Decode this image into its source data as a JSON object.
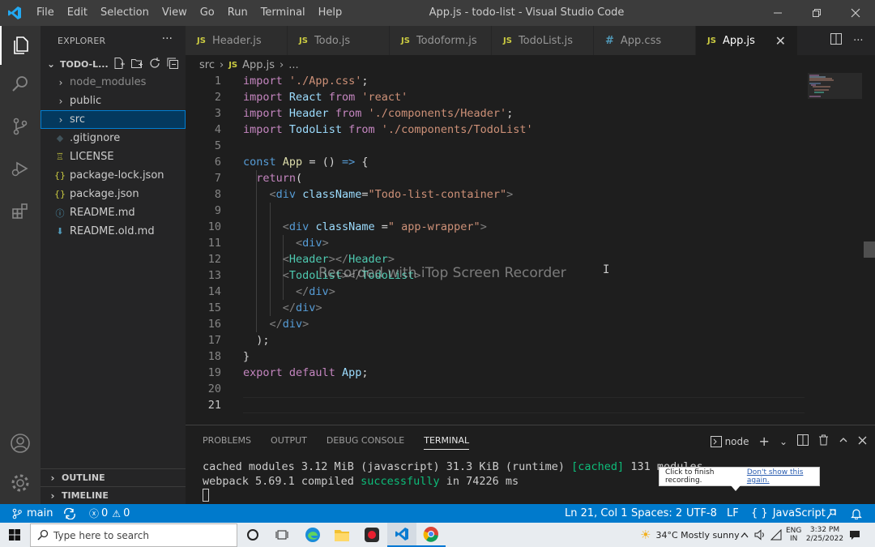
{
  "menu": [
    "File",
    "Edit",
    "Selection",
    "View",
    "Go",
    "Run",
    "Terminal",
    "Help"
  ],
  "window_title": "App.js - todo-list - Visual Studio Code",
  "sidebar": {
    "title": "EXPLORER",
    "folder": "TODO-L...",
    "items": [
      {
        "label": "node_modules",
        "icon": "chevron-right"
      },
      {
        "label": "public",
        "icon": "chevron-right"
      },
      {
        "label": "src",
        "icon": "chevron-right"
      },
      {
        "label": ".gitignore",
        "icon": "gitignore-icon"
      },
      {
        "label": "LICENSE",
        "icon": "license-icon"
      },
      {
        "label": "package-lock.json",
        "icon": "json-icon"
      },
      {
        "label": "package.json",
        "icon": "json-icon"
      },
      {
        "label": "README.md",
        "icon": "info-icon"
      },
      {
        "label": "README.old.md",
        "icon": "download-icon"
      }
    ],
    "outline": "OUTLINE",
    "timeline": "TIMELINE"
  },
  "tabs": [
    {
      "label": "Header.js",
      "icon": "JS"
    },
    {
      "label": "Todo.js",
      "icon": "JS"
    },
    {
      "label": "Todoform.js",
      "icon": "JS"
    },
    {
      "label": "TodoList.js",
      "icon": "JS"
    },
    {
      "label": "App.css",
      "icon": "#"
    },
    {
      "label": "App.js",
      "icon": "JS"
    }
  ],
  "breadcrumb": {
    "folder": "src",
    "file": "App.js",
    "more": "..."
  },
  "line_numbers": [
    "1",
    "2",
    "3",
    "4",
    "5",
    "6",
    "7",
    "8",
    "9",
    "10",
    "11",
    "12",
    "13",
    "14",
    "15",
    "16",
    "17",
    "18",
    "19",
    "20",
    "21"
  ],
  "watermark": "Recorded with iTop Screen Recorder",
  "panel": {
    "tabs": [
      "PROBLEMS",
      "OUTPUT",
      "DEBUG CONSOLE",
      "TERMINAL"
    ],
    "terminal_name": "node",
    "lines": {
      "l1a": "cached modules 3.12 MiB (javascript) 31.3 KiB (runtime) ",
      "l1b": "[cached]",
      "l1c": " 131 modules",
      "l2a": "webpack 5.69.1 compiled ",
      "l2b": "successfully",
      "l2c": " in 74226 ms"
    }
  },
  "tooltip": {
    "text": "Click to finish recording.",
    "link": "Don't show this again."
  },
  "statusbar": {
    "branch": "main",
    "errors": "0",
    "warnings": "0",
    "position": "Ln 21, Col 1",
    "spaces": "Spaces: 2",
    "encoding": "UTF-8",
    "eol": "LF",
    "language": "JavaScript"
  },
  "taskbar": {
    "search_placeholder": "Type here to search",
    "weather": "34°C  Mostly sunny",
    "lang_top": "ENG",
    "lang_bottom": "IN",
    "time": "3:32 PM",
    "date": "2/25/2022"
  }
}
